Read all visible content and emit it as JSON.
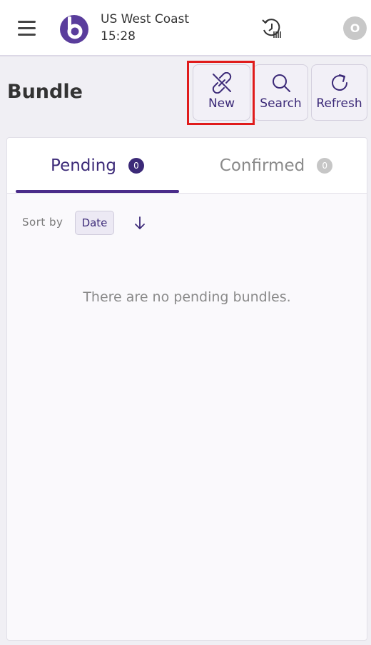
{
  "header": {
    "location": "US West Coast",
    "time": "15:28",
    "avatar_initial": "O"
  },
  "page": {
    "title": "Bundle"
  },
  "actions": {
    "new_label": "New",
    "search_label": "Search",
    "refresh_label": "Refresh"
  },
  "tabs": [
    {
      "label": "Pending",
      "count": "0",
      "active": true
    },
    {
      "label": "Confirmed",
      "count": "0",
      "active": false
    }
  ],
  "sort": {
    "label": "Sort by",
    "value": "Date"
  },
  "empty_state": "There are no pending bundles.",
  "colors": {
    "accent": "#3c2a78",
    "highlight": "#e01b1b",
    "background": "#f0eff4"
  },
  "icons": [
    "menu-icon",
    "logo-icon",
    "history-icon",
    "link-break-icon",
    "search-icon",
    "refresh-icon",
    "arrow-down-icon"
  ]
}
